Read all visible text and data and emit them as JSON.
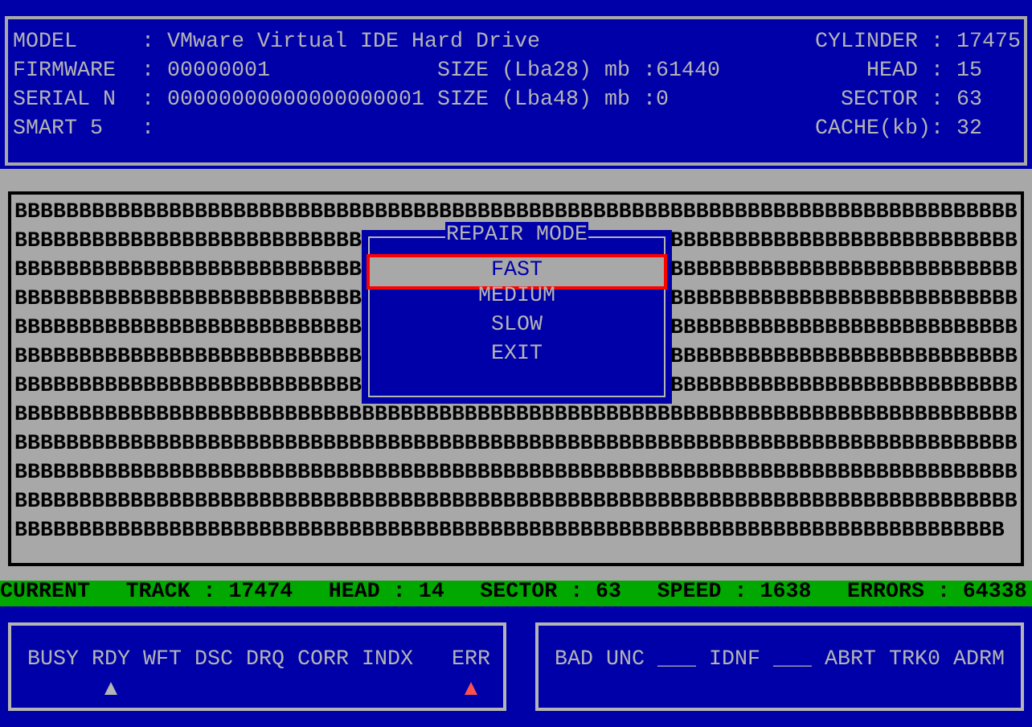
{
  "drive_info": {
    "left": [
      {
        "label": "MODEL",
        "sep": ":",
        "value": "VMware Virtual IDE Hard Drive"
      },
      {
        "label": "FIRMWARE",
        "sep": ":",
        "value": "00000001",
        "size": "SIZE (Lba28) mb :61440"
      },
      {
        "label": "SERIAL N",
        "sep": ":",
        "value": "00000000000000000001",
        "size": "SIZE (Lba48) mb :0"
      },
      {
        "label": "SMART 5",
        "sep": ":"
      }
    ],
    "right": [
      {
        "label": "CYLINDER :",
        "value": "17475"
      },
      {
        "label": "HEAD :",
        "value": "15"
      },
      {
        "label": "SECTOR :",
        "value": "63"
      },
      {
        "label": "CACHE(kb):",
        "value": "32"
      }
    ]
  },
  "surface_map": {
    "rows": [
      [
        "BBBBBBBBBBBBBBBBBBBBBBBBBBBBBBBBBBBBBBBBBBBBBBBBBBBBBBBBBBBBBBBBBBBBBBBBBBBBBB"
      ],
      [
        "BBBBBBBBBBBBBBBBBBBBBBBBBBB",
        "BBBBBBBBBBBBBBBBBBBBBBBBBBB"
      ],
      [
        "BBBBBBBBBBBBBBBBBBBBBBBBBBB",
        "BBBBBBBBBBBBBBBBBBBBBBBBBBB"
      ],
      [
        "BBBBBBBBBBBBBBBBBBBBBBBBBBB",
        "BBBBBBBBBBBBBBBBBBBBBBBBBBB"
      ],
      [
        "BBBBBBBBBBBBBBBBBBBBBBBBBBB",
        "BBBBBBBBBBBBBBBBBBBBBBBBBBB"
      ],
      [
        "BBBBBBBBBBBBBBBBBBBBBBBBBBB",
        "BBBBBBBBBBBBBBBBBBBBBBBBBBB"
      ],
      [
        "BBBBBBBBBBBBBBBBBBBBBBBBBBB",
        "BBBBBBBBBBBBBBBBBBBBBBBBBBB"
      ],
      [
        "BBBBBBBBBBBBBBBBBBBBBBBBBBBBBBBBBBBBBBBBBBBBBBBBBBBBBBBBBBBBBBBBBBBBBBBBBBBBBB"
      ],
      [
        "BBBBBBBBBBBBBBBBBBBBBBBBBBBBBBBBBBBBBBBBBBBBBBBBBBBBBBBBBBBBBBBBBBBBBBBBBBBBBB"
      ],
      [
        "BBBBBBBBBBBBBBBBBBBBBBBBBBBBBBBBBBBBBBBBBBBBBBBBBBBBBBBBBBBBBBBBBBBBBBBBBBBBBB"
      ],
      [
        "BBBBBBBBBBBBBBBBBBBBBBBBBBBBBBBBBBBBBBBBBBBBBBBBBBBBBBBBBBBBBBBBBBBBBBBBBBBBBB"
      ],
      [
        "BBBBBBBBBBBBBBBBBBBBBBBBBBBBBBBBBBBBBBBBBBBBBBBBBBBBBBBBBBBBBBBBBBBBBBBBBBBBB"
      ]
    ]
  },
  "repair_dialog": {
    "title": "REPAIR MODE",
    "items": [
      {
        "label": "FAST",
        "selected": true
      },
      {
        "label": "MEDIUM",
        "selected": false
      },
      {
        "label": "SLOW",
        "selected": false
      },
      {
        "label": "EXIT",
        "selected": false
      }
    ]
  },
  "status_bar": {
    "label": "CURRENT",
    "items": [
      {
        "label": "TRACK :",
        "value": "17474"
      },
      {
        "label": "HEAD :",
        "value": "14"
      },
      {
        "label": "SECTOR :",
        "value": "63"
      },
      {
        "label": "SPEED :",
        "value": "1638"
      },
      {
        "label": "ERRORS :",
        "value": "64338"
      }
    ]
  },
  "status_flags": [
    {
      "label": "BUSY",
      "lit": false
    },
    {
      "label": "RDY",
      "lit": true,
      "color": "#b4b4b4"
    },
    {
      "label": "WFT",
      "lit": false
    },
    {
      "label": "DSC",
      "lit": false
    },
    {
      "label": "DRQ",
      "lit": false
    },
    {
      "label": "CORR",
      "lit": false
    },
    {
      "label": "INDX",
      "lit": false
    },
    {
      "label": "ERR",
      "lit": true,
      "color": "#ff5050"
    }
  ],
  "error_flags": [
    "BAD",
    "UNC",
    "___",
    "IDNF",
    "___",
    "ABRT",
    "TRK0",
    "ADRM"
  ]
}
